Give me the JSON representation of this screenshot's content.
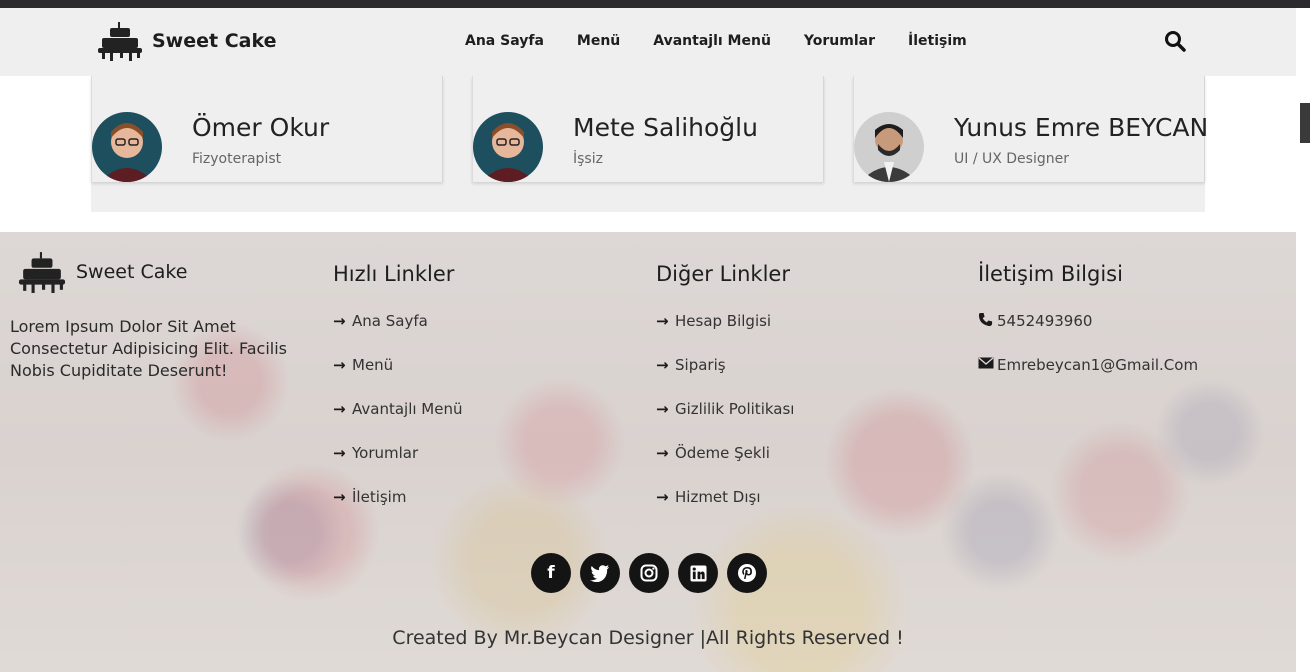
{
  "header": {
    "brand": "Sweet Cake",
    "nav": [
      "Ana Sayfa",
      "Menü",
      "Avantajlı Menü",
      "Yorumlar",
      "İletişim"
    ]
  },
  "team": [
    {
      "name": "Ömer Okur",
      "role": "Fizyoterapist"
    },
    {
      "name": "Mete Salihoğlu",
      "role": "İşsiz"
    },
    {
      "name": "Yunus Emre BEYCAN",
      "role": "UI / UX Designer"
    }
  ],
  "footer": {
    "brand": "Sweet Cake",
    "about": "Lorem Ipsum Dolor Sit Amet Consectetur Adipisicing Elit. Facilis Nobis Cupiditate Deserunt!",
    "quick_links": {
      "title": "Hızlı Linkler",
      "items": [
        "Ana Sayfa",
        "Menü",
        "Avantajlı Menü",
        "Yorumlar",
        "İletişim"
      ]
    },
    "other_links": {
      "title": "Diğer Linkler",
      "items": [
        "Hesap Bilgisi",
        "Sipariş",
        "Gizlilik Politikası",
        "Ödeme Şekli",
        "Hizmet Dışı"
      ]
    },
    "contact": {
      "title": "İletişim Bilgisi",
      "phone": "5452493960",
      "email": "Emrebeycan1@Gmail.Com"
    },
    "social": [
      "facebook-icon",
      "twitter-icon",
      "instagram-icon",
      "linkedin-icon",
      "pinterest-icon"
    ],
    "credit": "Created By Mr.Beycan Designer |All Rights Reserved !"
  }
}
